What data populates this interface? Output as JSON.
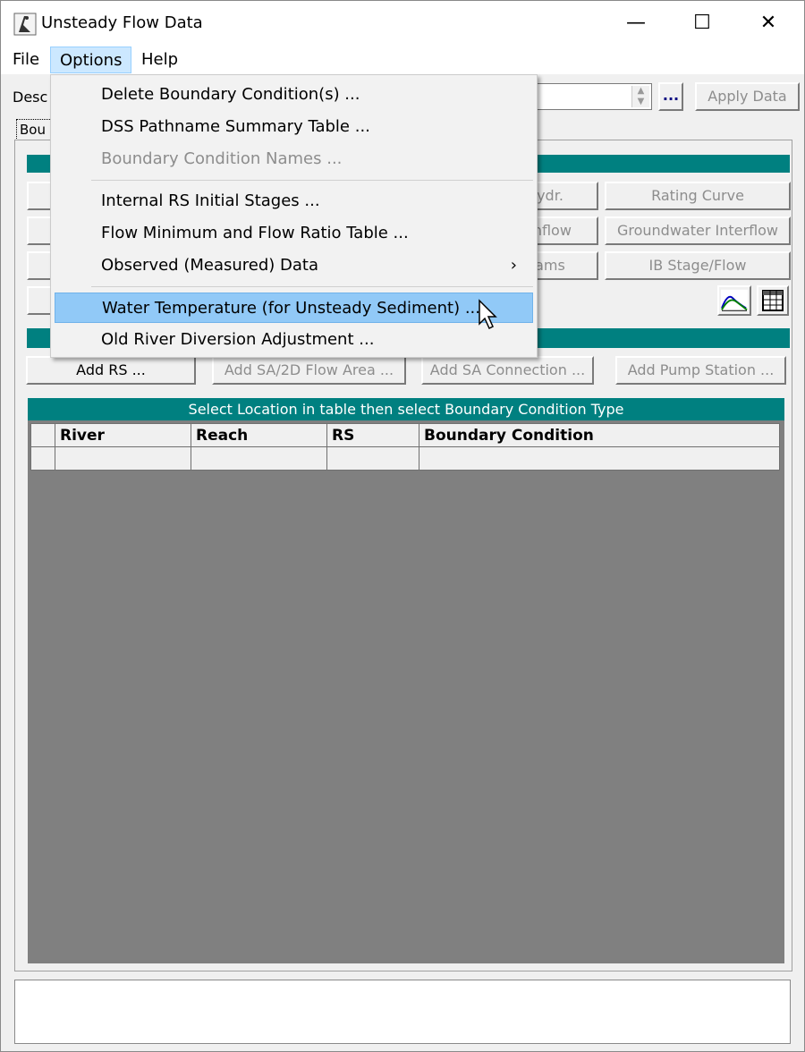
{
  "window": {
    "title": "Unsteady Flow Data",
    "controls": {
      "minimize": "—",
      "maximize": "☐",
      "close": "✕"
    }
  },
  "menubar": {
    "file": "File",
    "options": "Options",
    "help": "Help"
  },
  "description": {
    "label": "Desc",
    "browse_label": "...",
    "apply_label": "Apply Data"
  },
  "tab_label": "Bou",
  "boundary_buttons": {
    "hydr_partial": "ydr.",
    "rating_curve": "Rating Curve",
    "inflow_partial": "Inflow",
    "groundwater": "Groundwater Interflow",
    "gates_partial": "ams",
    "ib_stage": "IB Stage/Flow"
  },
  "location_buttons": {
    "add_rs": "Add RS ...",
    "add_sa": "Add SA/2D Flow Area ...",
    "add_sa_conn": "Add SA Connection ...",
    "add_pump": "Add Pump Station ..."
  },
  "table": {
    "banner": "Select Location in table then select Boundary Condition Type",
    "headers": [
      "River",
      "Reach",
      "RS",
      "Boundary Condition"
    ],
    "rows": [
      [
        "",
        "",
        "",
        ""
      ]
    ]
  },
  "options_menu": {
    "items": [
      {
        "label": "Delete Boundary Condition(s) ...",
        "enabled": true
      },
      {
        "label": "DSS Pathname Summary Table ...",
        "enabled": true
      },
      {
        "label": "Boundary Condition Names ...",
        "enabled": false
      },
      {
        "label": "Internal RS Initial Stages ...",
        "enabled": true
      },
      {
        "label": "Flow Minimum and Flow Ratio Table ...",
        "enabled": true
      },
      {
        "label": "Observed (Measured) Data",
        "enabled": true,
        "submenu": true
      },
      {
        "label": "Water Temperature (for Unsteady Sediment) ...",
        "enabled": true,
        "hovered": true
      },
      {
        "label": "Old River Diversion Adjustment ...",
        "enabled": true
      }
    ],
    "submenu_glyph": "›"
  },
  "icons": {
    "plot": "plot-icon",
    "table": "table-icon",
    "app": "hecras-app-icon"
  },
  "colors": {
    "accent": "#008080",
    "menu_hover": "#91c9f7",
    "grid_bg": "#808080"
  }
}
